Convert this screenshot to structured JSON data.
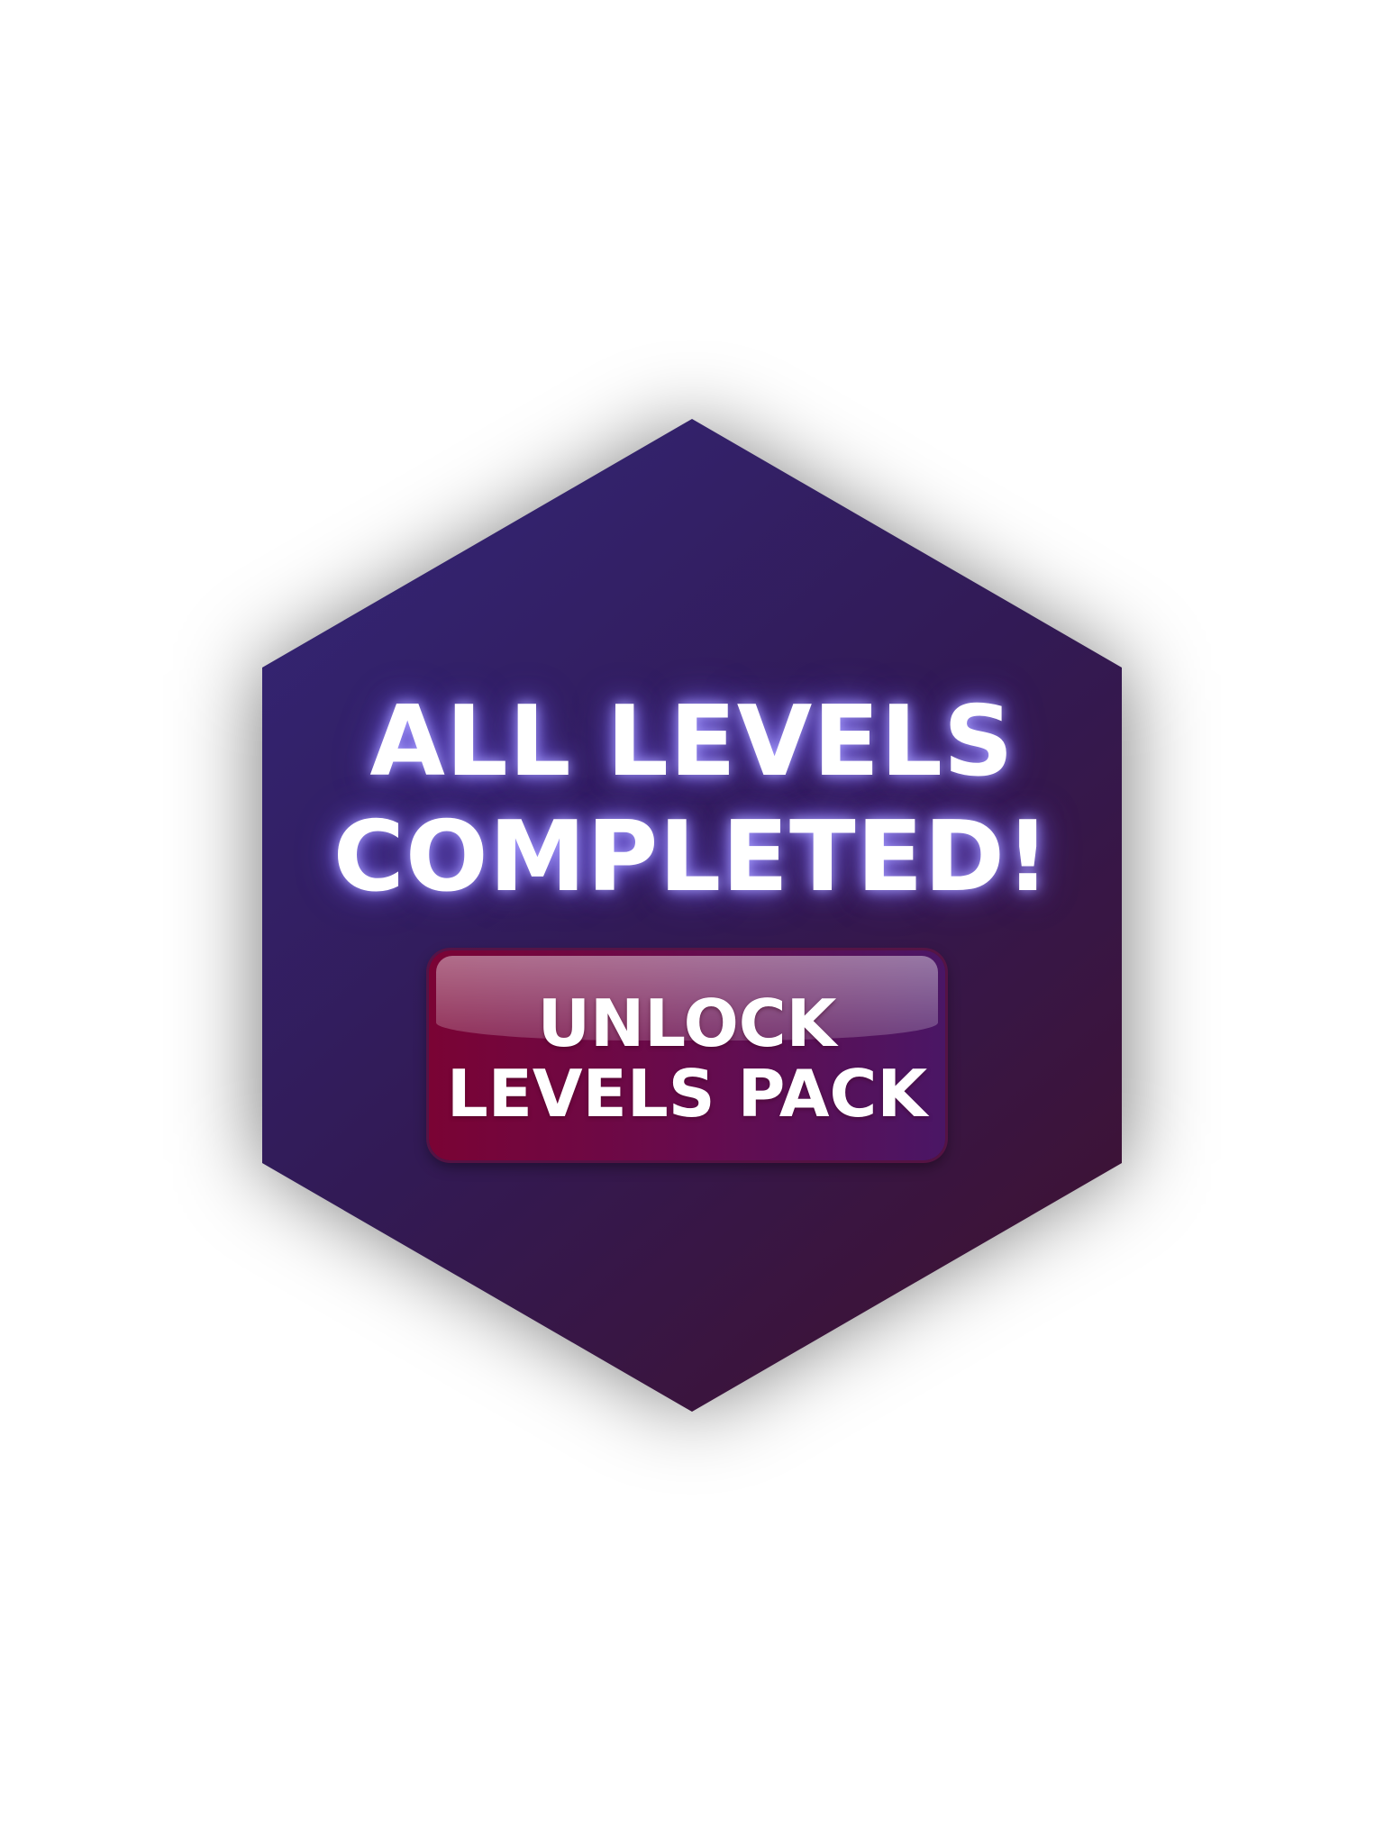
{
  "dialog": {
    "title_line1": "ALL LEVELS",
    "title_line2": "COMPLETED!",
    "button": {
      "line1": "UNLOCK",
      "line2": "LEVELS PACK"
    }
  },
  "colors": {
    "background": "#ffffff",
    "hex_top_left": "#34277a",
    "hex_bottom_right": "#41102c",
    "button_left": "#7a0334",
    "button_right": "#4a1665",
    "text": "#ffffff"
  }
}
